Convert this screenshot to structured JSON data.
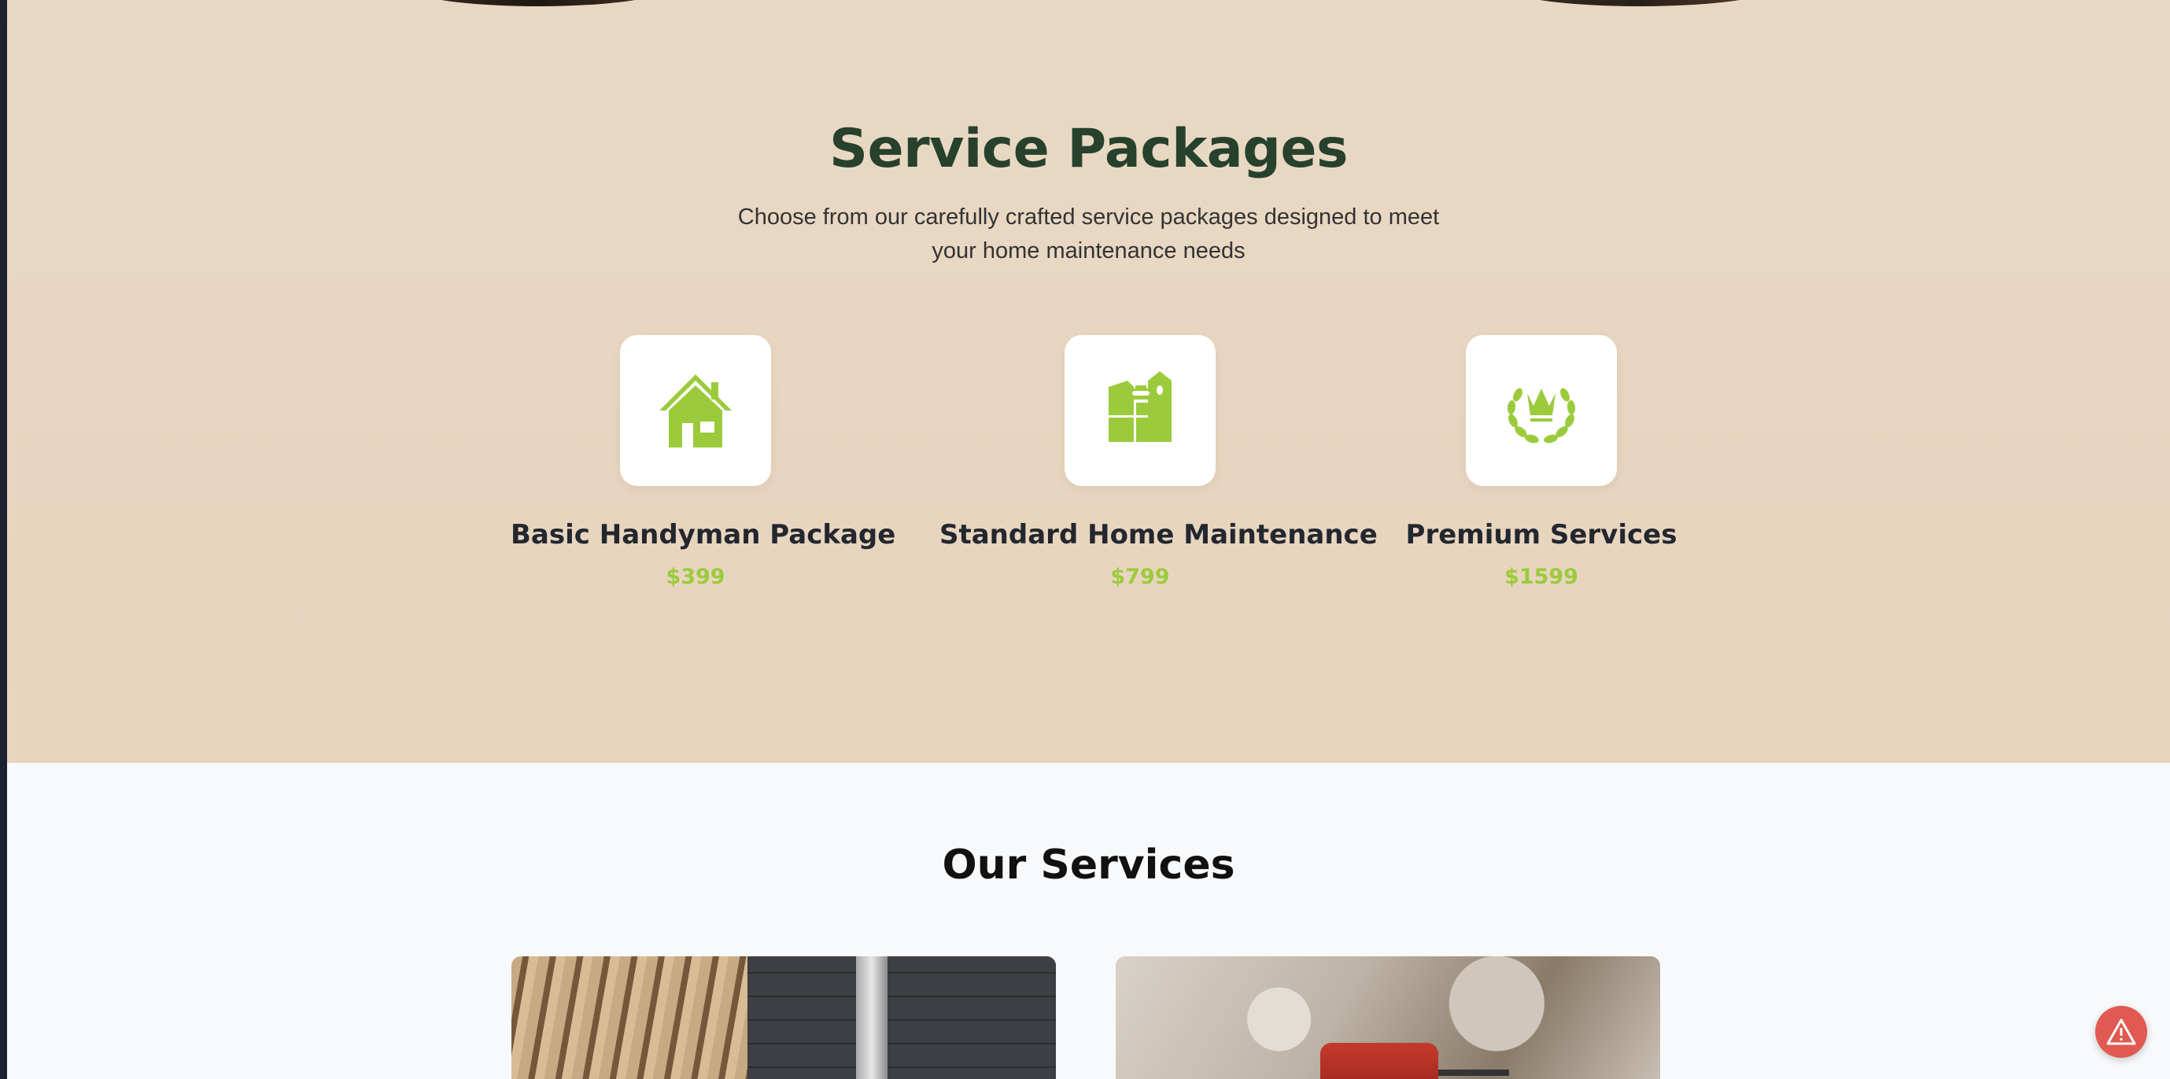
{
  "packages_section": {
    "title": "Service Packages",
    "subtitle": "Choose from our carefully crafted service packages designed to meet your home maintenance needs",
    "items": [
      {
        "name": "Basic Handyman Package",
        "price": "$399",
        "icon": "house-icon"
      },
      {
        "name": "Standard Home Maintenance",
        "price": "$799",
        "icon": "toolbox-icon"
      },
      {
        "name": "Premium Services",
        "price": "$1599",
        "icon": "crown-laurel-icon"
      }
    ]
  },
  "services_section": {
    "title": "Our Services"
  },
  "floating_button": {
    "icon": "warning-icon"
  },
  "colors": {
    "accent_green": "#9bcb3c",
    "heading_green": "#27412d",
    "packages_bg": "#e8d7c2",
    "services_bg": "#f8f9fb",
    "warning_red": "#e05a52"
  }
}
